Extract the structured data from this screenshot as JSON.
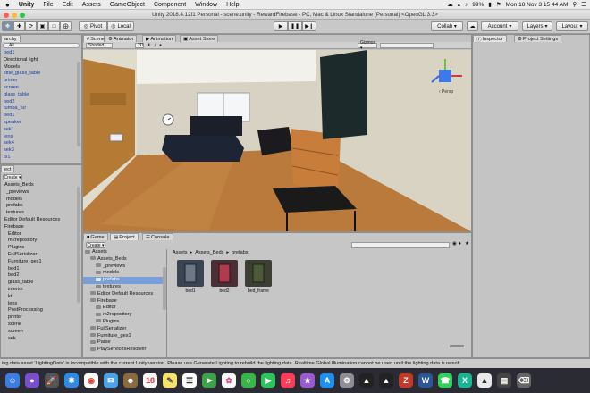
{
  "menubar": {
    "app": "Unity",
    "items": [
      "File",
      "Edit",
      "Assets",
      "GameObject",
      "Component",
      "Window",
      "Help"
    ],
    "battery": "99%",
    "clock": "Mon 18 Nov  3 15 44 AM"
  },
  "window": {
    "title": "Unity 2018.4.12f1 Personal - scene.unity - RewardFirebase - PC, Mac & Linux Standalone (Personal) <OpenGL 3.3>"
  },
  "toolbar": {
    "pivot": "Pivot",
    "local": "Local",
    "collab": "Collab ▾",
    "account": "Account",
    "layers": "Layers",
    "layout": "Layout"
  },
  "hierarchy": {
    "tab": "archy",
    "search": "All",
    "items": [
      "bed1",
      "Directional light",
      "Models",
      "little_glass_table",
      "printer",
      "screen",
      "glass_table",
      "bed2",
      "tumba_fur",
      "bed1",
      "speaker",
      "sek1",
      "lens",
      "sek4",
      "sek3",
      "tv1"
    ]
  },
  "scene": {
    "tabs": [
      "Scene",
      "Animator",
      "Animation",
      "Asset Store"
    ],
    "shading": "Shaded",
    "mode": "2D",
    "gizmos": "Gizmos ▾",
    "persp": "‹ Persp"
  },
  "inspector": {
    "tabs": [
      "Inspector",
      "Project Settings"
    ]
  },
  "project_left": {
    "tab": "ect",
    "create": "Create ▾",
    "items": [
      "Assets_Beds",
      "_previews",
      "models",
      "prefabs",
      "textures",
      "Editor Default Resources",
      "Firebase",
      "Editor",
      "m2repository",
      "Plugins",
      "FullSerializer",
      "Furniture_ges1",
      "bed1",
      "bed2",
      "glass_table",
      "interior",
      "kt",
      "lens",
      "PostProcessing",
      "printer",
      "scene",
      "screen",
      "sek"
    ]
  },
  "bottom": {
    "tabs": [
      "Game",
      "Project",
      "Console"
    ],
    "create": "Create ▾",
    "tree": [
      "Assets",
      "Assets_Beds",
      "_previews",
      "models",
      "prefabs",
      "textures",
      "Editor Default Resources",
      "Firebase",
      "Editor",
      "m2repository",
      "Plugins",
      "FullSerializer",
      "Furniture_ges1",
      "Parse",
      "PlayServicesResolver"
    ],
    "breadcrumb": [
      "Assets",
      "Assets_Beds",
      "prefabs"
    ],
    "assets": [
      "bed1",
      "bed2",
      "bed_frame"
    ]
  },
  "status": {
    "text": "ing data asset 'LightingData' is incompatible with the current Unity version. Please use Generate Lighting to rebuild the lighting data. Realtime Global Illumination cannot be used until the lighting data is rebuilt."
  },
  "colors": {
    "accent": "#2d6df2",
    "selection": "#7a9fd8",
    "hierarchy_text": "#1b3da8"
  }
}
